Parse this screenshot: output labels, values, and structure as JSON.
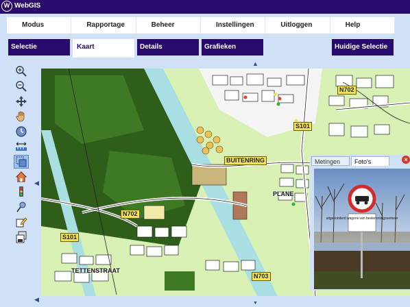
{
  "app": {
    "title": "WebGIS",
    "logo_text": "W"
  },
  "menu": {
    "items": [
      "Modus",
      "Rapportage",
      "Beheer",
      "Instellingen",
      "Uitloggen",
      "Help"
    ]
  },
  "tabs": {
    "items": [
      "Selectie",
      "Kaart",
      "Details",
      "Grafieken"
    ],
    "active": "Kaart",
    "right": "Huidige Selectie"
  },
  "tools": [
    "zoom-in-icon",
    "zoom-out-icon",
    "pan-move-icon",
    "hand-icon",
    "history-icon",
    "measure-icon",
    "select-box-icon",
    "home-icon",
    "traffic-light-icon",
    "pin-icon",
    "edit-icon",
    "save-icon"
  ],
  "map": {
    "road_labels": [
      "N702",
      "S101",
      "BUITENRING",
      "N702",
      "S101",
      "N703"
    ],
    "place_labels": [
      "PLANE",
      "TETTENSTRAAT"
    ],
    "arrows": {
      "up": "▲",
      "down": "▼",
      "left": "◀",
      "right": "▶"
    }
  },
  "photo_panel": {
    "tabs": [
      "Metingen",
      "Foto's"
    ],
    "active_tab": "Foto's",
    "close_symbol": "×",
    "sign_text": "uitgezonderd wagens van bestemmingsverkeer"
  },
  "colors": {
    "primary": "#2b0a6e",
    "panel": "#cfe0f7",
    "park_dark": "#2e5e1a",
    "park_light": "#d8f0b4",
    "water": "#a9dfe3",
    "road_label": "#f2e455"
  }
}
